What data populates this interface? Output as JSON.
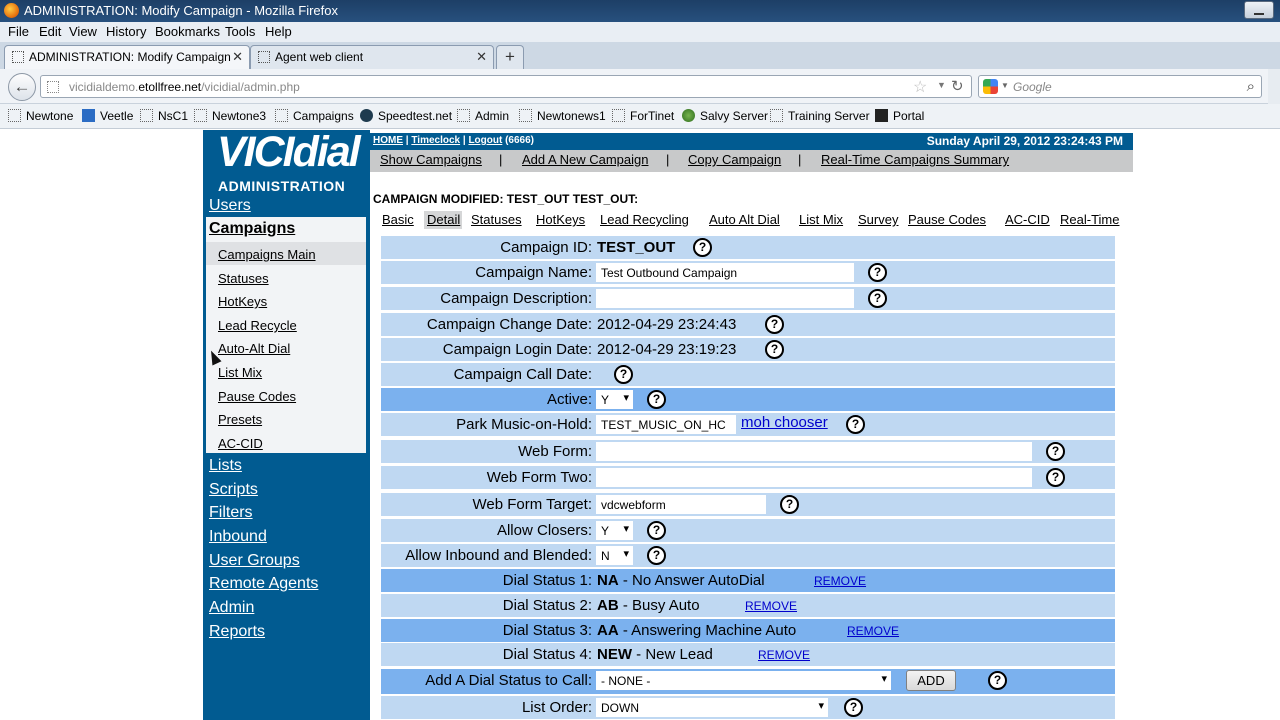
{
  "window": {
    "title": "ADMINISTRATION: Modify Campaign - Mozilla Firefox"
  },
  "menubar": [
    "File",
    "Edit",
    "View",
    "History",
    "Bookmarks",
    "Tools",
    "Help"
  ],
  "tabs": [
    {
      "label": "ADMINISTRATION: Modify Campaign",
      "active": true
    },
    {
      "label": "Agent web client",
      "active": false
    }
  ],
  "newtab_label": "+",
  "urlbar": {
    "domain_prefix": "vicidialdemo.",
    "domain": "etollfree.net",
    "path": "/vicidial/admin.php"
  },
  "search": {
    "placeholder": "Google"
  },
  "bookmarks": [
    {
      "label": "Newtone",
      "icon": "page-icon"
    },
    {
      "label": "Veetle",
      "icon": "veetle-icon"
    },
    {
      "label": "NsC1",
      "icon": "page-icon"
    },
    {
      "label": "Newtone3",
      "icon": "page-icon"
    },
    {
      "label": "Campaigns",
      "icon": "page-icon"
    },
    {
      "label": "Speedtest.net",
      "icon": "speedtest-icon"
    },
    {
      "label": "Admin",
      "icon": "page-icon"
    },
    {
      "label": "Newtonews1",
      "icon": "page-icon"
    },
    {
      "label": "ForTinet",
      "icon": "page-icon"
    },
    {
      "label": "Salvy Server",
      "icon": "globe-icon"
    },
    {
      "label": "Training Server",
      "icon": "page-icon"
    },
    {
      "label": "Portal",
      "icon": "portal-icon"
    }
  ],
  "logo": {
    "top": "VICIdial",
    "bottom": "ADMINISTRATION"
  },
  "sidebar": {
    "users": "Users",
    "campaigns": "Campaigns",
    "campaign_sub": [
      "Campaigns Main",
      "Statuses",
      "HotKeys",
      "Lead Recycle",
      "Auto-Alt Dial",
      "List Mix",
      "Pause Codes",
      "Presets",
      "AC-CID"
    ],
    "lower": [
      "Lists",
      "Scripts",
      "Filters",
      "Inbound",
      "User Groups",
      "Remote Agents",
      "Admin",
      "Reports"
    ]
  },
  "topbar": {
    "home": "HOME",
    "sep1": " | ",
    "timeclock": "Timeclock",
    "sep2": " | ",
    "logout": "Logout",
    "logout_user": " (6666)",
    "date": "Sunday April 29, 2012 23:24:43 PM"
  },
  "subnav": {
    "items": [
      "Show Campaigns",
      "Add A New Campaign",
      "Copy Campaign",
      "Real-Time Campaigns Summary"
    ],
    "separator": "|"
  },
  "modified_msg": "CAMPAIGN MODIFIED: TEST_OUT TEST_OUT:",
  "campaign_tabs": [
    "Basic",
    "Detail",
    "Statuses",
    "HotKeys",
    "Lead Recycling",
    "Auto Alt Dial",
    "List Mix",
    "Survey",
    "Pause Codes",
    "AC-CID",
    "Real-Time"
  ],
  "selected_tab": "Detail",
  "help_glyph": "?",
  "form": {
    "campaign_id": {
      "label": "Campaign ID:",
      "value": "TEST_OUT"
    },
    "campaign_name": {
      "label": "Campaign Name:",
      "value": "Test Outbound Campaign"
    },
    "campaign_description": {
      "label": "Campaign Description:",
      "value": ""
    },
    "campaign_change_date": {
      "label": "Campaign Change Date:",
      "value": "2012-04-29 23:24:43"
    },
    "campaign_login_date": {
      "label": "Campaign Login Date:",
      "value": "2012-04-29 23:19:23"
    },
    "campaign_call_date": {
      "label": "Campaign Call Date:",
      "value": ""
    },
    "active": {
      "label": "Active:",
      "value": "Y"
    },
    "park_moh": {
      "label": "Park Music-on-Hold:",
      "value": "TEST_MUSIC_ON_HC",
      "chooser": "moh chooser"
    },
    "web_form": {
      "label": "Web Form:",
      "value": ""
    },
    "web_form_two": {
      "label": "Web Form Two:",
      "value": ""
    },
    "web_form_target": {
      "label": "Web Form Target:",
      "value": "vdcwebform"
    },
    "allow_closers": {
      "label": "Allow Closers:",
      "value": "Y"
    },
    "allow_inbound_blended": {
      "label": "Allow Inbound and Blended:",
      "value": "N"
    },
    "dial_statuses": [
      {
        "label": "Dial Status 1:",
        "code": "NA",
        "desc": " - No Answer AutoDial",
        "action": "REMOVE"
      },
      {
        "label": "Dial Status 2:",
        "code": "AB",
        "desc": " - Busy Auto",
        "action": "REMOVE"
      },
      {
        "label": "Dial Status 3:",
        "code": "AA",
        "desc": " - Answering Machine Auto",
        "action": "REMOVE"
      },
      {
        "label": "Dial Status 4:",
        "code": "NEW",
        "desc": " - New Lead",
        "action": "REMOVE"
      }
    ],
    "add_dial_status": {
      "label": "Add A Dial Status to Call:",
      "value": "- NONE -",
      "button": "ADD"
    },
    "list_order": {
      "label": "List Order:",
      "value": "DOWN"
    }
  }
}
